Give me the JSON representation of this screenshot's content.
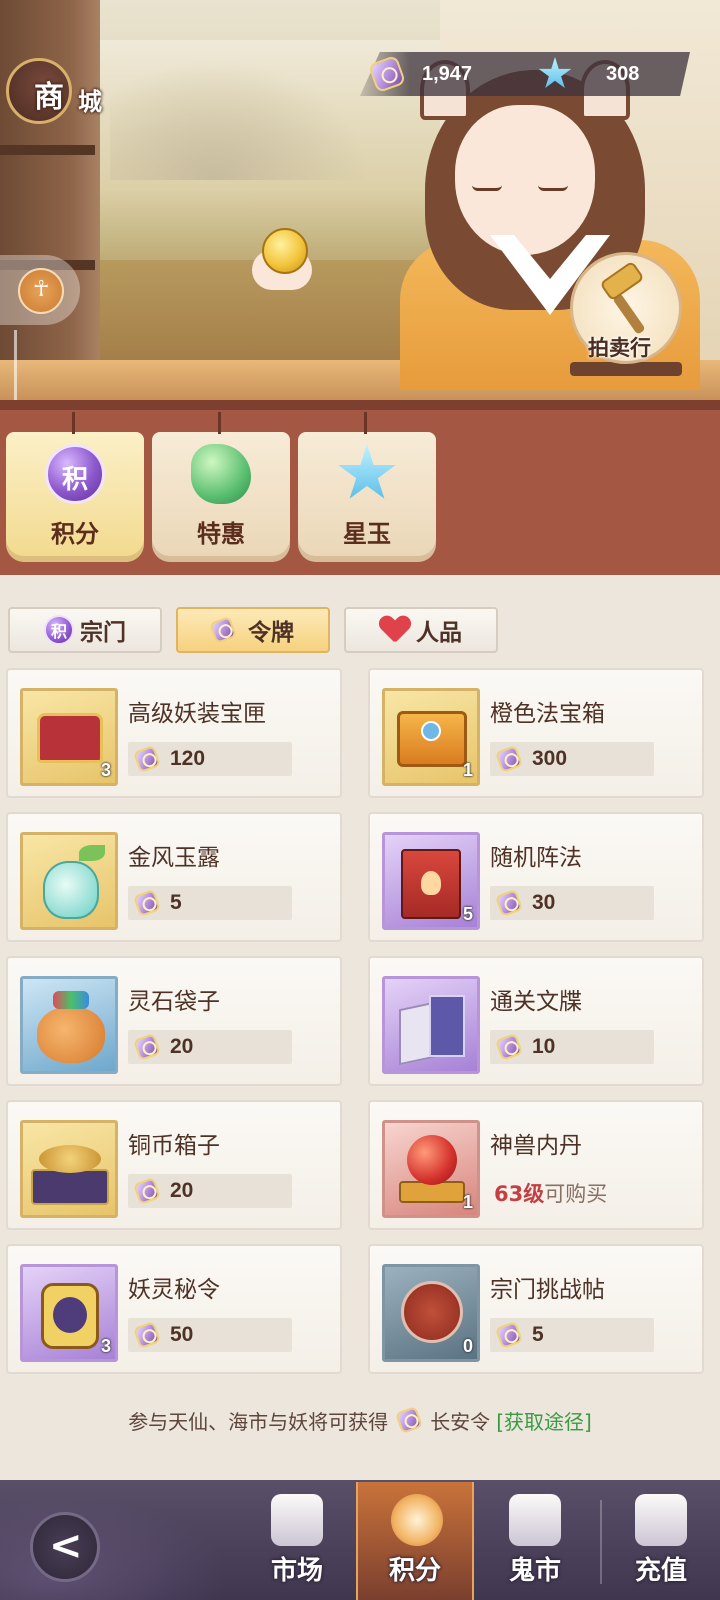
{
  "header": {
    "title_char1": "商",
    "title_char2": "城",
    "currency": [
      {
        "icon": "token-icon",
        "value": "1,947"
      },
      {
        "icon": "star-jade-icon",
        "value": "308"
      }
    ],
    "auction_label": "拍卖行"
  },
  "category_tabs": [
    {
      "label": "积分",
      "icon": "jifen-icon",
      "icon_char": "积",
      "active": true
    },
    {
      "label": "特惠",
      "icon": "tehui-icon",
      "active": false
    },
    {
      "label": "星玉",
      "icon": "xingyu-icon",
      "active": false
    }
  ],
  "sub_tabs": [
    {
      "label": "宗门",
      "icon_char": "积",
      "active": false
    },
    {
      "label": "令牌",
      "active": true
    },
    {
      "label": "人品",
      "active": false
    }
  ],
  "items": [
    {
      "name": "高级妖装宝匣",
      "price": "120",
      "count": "3",
      "frame": "gold",
      "icon": "treasure-chest-icon"
    },
    {
      "name": "橙色法宝箱",
      "price": "300",
      "count": "1",
      "frame": "gold",
      "icon": "orange-chest-icon"
    },
    {
      "name": "金风玉露",
      "price": "5",
      "count": "",
      "frame": "gold",
      "icon": "potion-bottle-icon"
    },
    {
      "name": "随机阵法",
      "price": "30",
      "count": "5",
      "frame": "purple",
      "icon": "formation-book-icon"
    },
    {
      "name": "灵石袋子",
      "price": "20",
      "count": "",
      "frame": "blue",
      "icon": "gem-bag-icon"
    },
    {
      "name": "通关文牒",
      "price": "10",
      "count": "",
      "frame": "purple",
      "icon": "pass-document-icon"
    },
    {
      "name": "铜币箱子",
      "price": "20",
      "count": "",
      "frame": "gold",
      "icon": "coin-box-icon"
    },
    {
      "name": "神兽内丹",
      "req_level": "63级",
      "req_text": "可购买",
      "count": "1",
      "frame": "red",
      "icon": "beast-orb-icon"
    },
    {
      "name": "妖灵秘令",
      "price": "50",
      "count": "3",
      "frame": "purple",
      "icon": "spirit-token-icon"
    },
    {
      "name": "宗门挑战帖",
      "price": "5",
      "count": "0",
      "frame": "slate",
      "icon": "challenge-seal-icon"
    }
  ],
  "footer": {
    "info_prefix": "参与天仙、海市与妖将可获得",
    "info_token": "长安令",
    "info_link": "[获取途径]"
  },
  "bottom_nav": [
    {
      "label": "市场",
      "active": false
    },
    {
      "label": "积分",
      "active": true
    },
    {
      "label": "鬼市",
      "active": false
    },
    {
      "label": "充值",
      "active": false
    }
  ],
  "colors": {
    "accent_gold": "#f2d27f",
    "band_red": "#a45844",
    "link_green": "#3c9a43",
    "level_red": "#c33f44"
  }
}
